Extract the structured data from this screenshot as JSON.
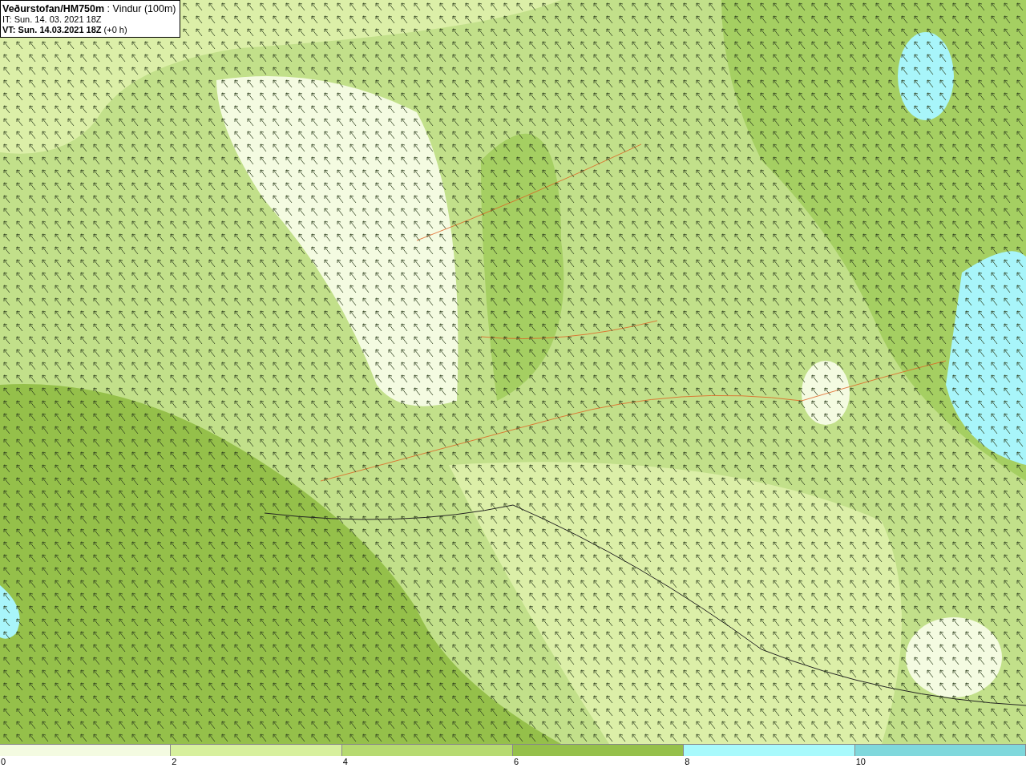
{
  "title_box": {
    "lines": [
      "**Veðurstofan/HM750m** : Vindur (100m)",
      "IT: Sun. 14. 03. 2021 18Z",
      "**VT: Sun. 14.03.2021 18Z** (+0 h)"
    ]
  },
  "legend": [
    {
      "label": "0",
      "color": "#f4fbe1"
    },
    {
      "label": "2",
      "color": "#d7f09d"
    },
    {
      "label": "4",
      "color": "#b6da70"
    },
    {
      "label": "6",
      "color": "#95c04a"
    },
    {
      "label": "8",
      "color": "#a8fafc"
    },
    {
      "label": "10",
      "color": "#7fd8dc"
    }
  ]
}
